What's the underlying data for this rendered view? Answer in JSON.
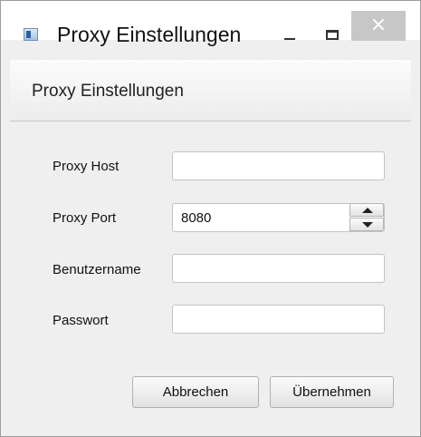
{
  "window": {
    "title": "Proxy Einstellungen",
    "controls": {
      "minimize": "−",
      "maximize": "□",
      "close": "×"
    }
  },
  "header": {
    "title": "Proxy Einstellungen"
  },
  "form": {
    "proxy_host": {
      "label": "Proxy Host",
      "value": ""
    },
    "proxy_port": {
      "label": "Proxy Port",
      "value": "8080"
    },
    "username": {
      "label": "Benutzername",
      "value": ""
    },
    "password": {
      "label": "Passwort",
      "value": ""
    }
  },
  "buttons": {
    "cancel": "Abbrechen",
    "apply": "Übernehmen"
  },
  "colors": {
    "window_bg": "#efefef",
    "titlebar_bg": "#ffffff",
    "close_bg": "#c7c7c7",
    "border": "#c3c3c3"
  },
  "icons": {
    "app": "app-window-icon",
    "spinner_up": "triangle-up-icon",
    "spinner_down": "triangle-down-icon"
  }
}
